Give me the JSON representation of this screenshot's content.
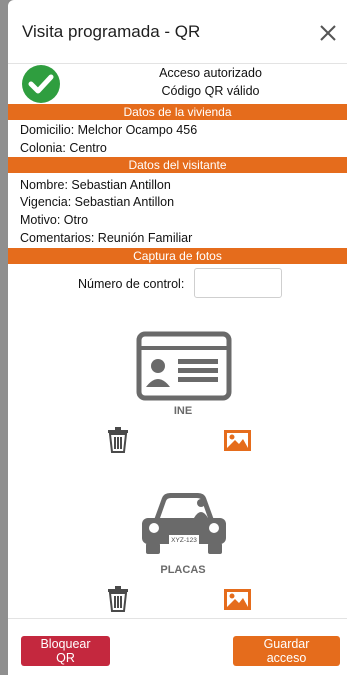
{
  "modal": {
    "title": "Visita programada - QR"
  },
  "status": {
    "line1": "Acceso autorizado",
    "line2": "Código QR válido"
  },
  "sections": {
    "vivienda": "Datos de la vivienda",
    "visitante": "Datos del visitante",
    "fotos": "Captura de fotos"
  },
  "vivienda": {
    "domicilio": "Domicilio: Melchor Ocampo 456",
    "colonia": "Colonia: Centro"
  },
  "visitante": {
    "nombre": "Nombre: Sebastian Antillon",
    "vigencia": "Vigencia: Sebastian Antillon",
    "motivo": "Motivo: Otro",
    "comentarios": "Comentarios: Reunión Familiar"
  },
  "control": {
    "label": "Número de control:",
    "value": ""
  },
  "photos": {
    "ine_caption": "INE",
    "placas_caption": "PLACAS",
    "plate_text": "XYZ-123"
  },
  "buttons": {
    "block": "Bloquear QR",
    "save": "Guardar acceso"
  },
  "colors": {
    "accent": "#e56c1c",
    "danger": "#c4283e",
    "success": "#2f9e3f"
  },
  "icons": [
    "close-icon",
    "check-circle-icon",
    "id-card-icon",
    "car-icon",
    "trash-icon",
    "image-icon"
  ]
}
